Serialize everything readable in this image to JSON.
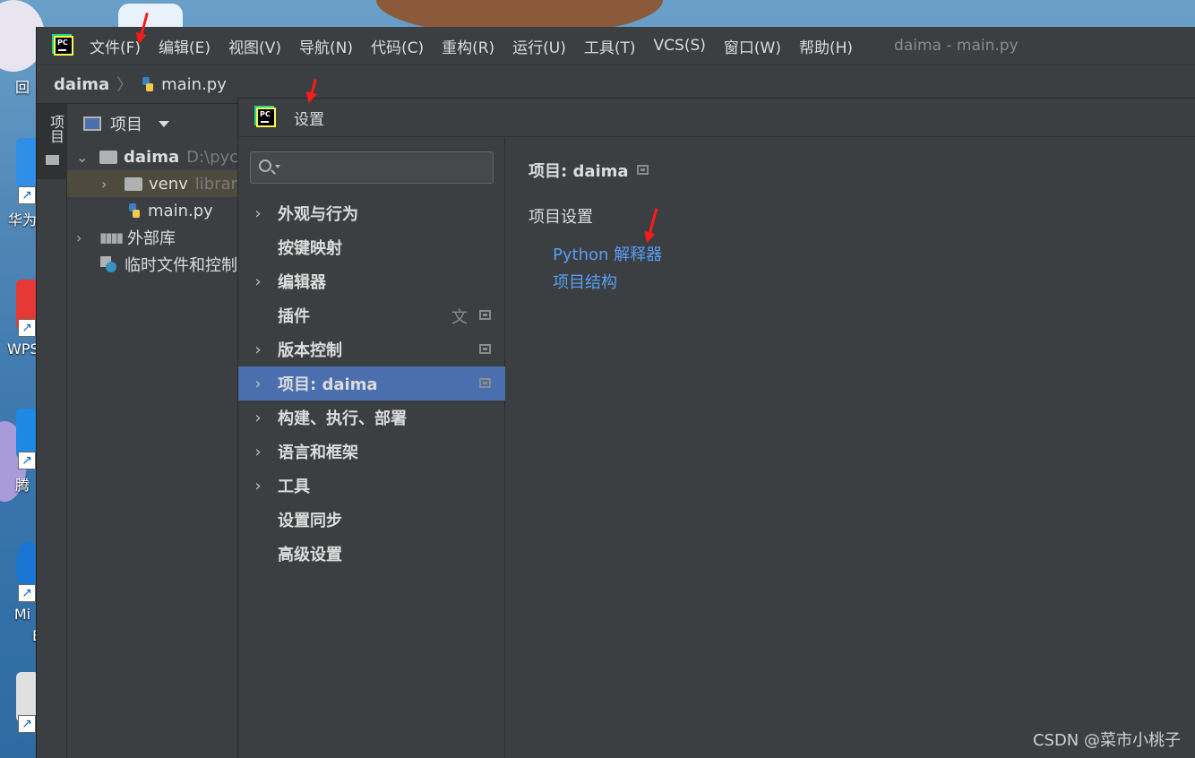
{
  "desktop": {
    "labels": [
      "回",
      "华为",
      "WPS",
      "腾",
      "Mi",
      "E"
    ]
  },
  "menubar": {
    "items": [
      "文件(F)",
      "编辑(E)",
      "视图(V)",
      "导航(N)",
      "代码(C)",
      "重构(R)",
      "运行(U)",
      "工具(T)",
      "VCS(S)",
      "窗口(W)",
      "帮助(H)"
    ],
    "window_title": "daima - main.py"
  },
  "navbar": {
    "root": "daima",
    "file": "main.py"
  },
  "toolstrip": {
    "tab_label": "项目"
  },
  "project_panel": {
    "title": "项目",
    "tree": {
      "root_name": "daima",
      "root_path": "D:\\pych",
      "venv_name": "venv",
      "venv_hint": "library",
      "main_file": "main.py",
      "external_libs": "外部库",
      "scratches": "临时文件和控制"
    }
  },
  "settings": {
    "title": "设置",
    "search": {
      "value": "",
      "placeholder": ""
    },
    "nav": [
      {
        "label": "外观与行为",
        "expandable": true
      },
      {
        "label": "按键映射",
        "expandable": false
      },
      {
        "label": "编辑器",
        "expandable": true
      },
      {
        "label": "插件",
        "expandable": false
      },
      {
        "label": "版本控制",
        "expandable": true
      },
      {
        "label": "项目: daima",
        "expandable": true,
        "active": true
      },
      {
        "label": "构建、执行、部署",
        "expandable": true
      },
      {
        "label": "语言和框架",
        "expandable": true
      },
      {
        "label": "工具",
        "expandable": true
      },
      {
        "label": "设置同步",
        "expandable": false
      },
      {
        "label": "高级设置",
        "expandable": false
      }
    ],
    "content": {
      "title": "项目: daima",
      "section": "项目设置",
      "links": [
        "Python 解释器",
        "项目结构"
      ]
    }
  },
  "watermark": "CSDN @菜市小桃子",
  "colors": {
    "active_row": "#4b6eaf",
    "link": "#589df6",
    "annotation_arrow": "#ff1a1a"
  }
}
